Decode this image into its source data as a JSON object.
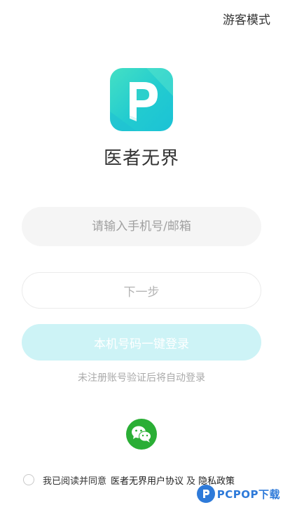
{
  "header": {
    "guest_mode": "游客模式"
  },
  "app": {
    "name": "医者无界",
    "logo_icon": "p-letter-logo",
    "logo_color": "#2cd1cc"
  },
  "login": {
    "phone_placeholder": "请输入手机号/邮箱",
    "phone_value": "",
    "next_label": "下一步",
    "one_key_label": "本机号码一键登录",
    "auto_register_hint": "未注册账号验证后将自动登录"
  },
  "social": {
    "wechat_icon": "wechat-icon",
    "wechat_color": "#2aae35"
  },
  "agreement": {
    "checked": false,
    "prefix": "我已阅读并同意",
    "user_agreement": "医者无界用户协议",
    "and": "及",
    "privacy_policy": "隐私政策"
  },
  "watermark": {
    "text": "PCPOP下载"
  }
}
